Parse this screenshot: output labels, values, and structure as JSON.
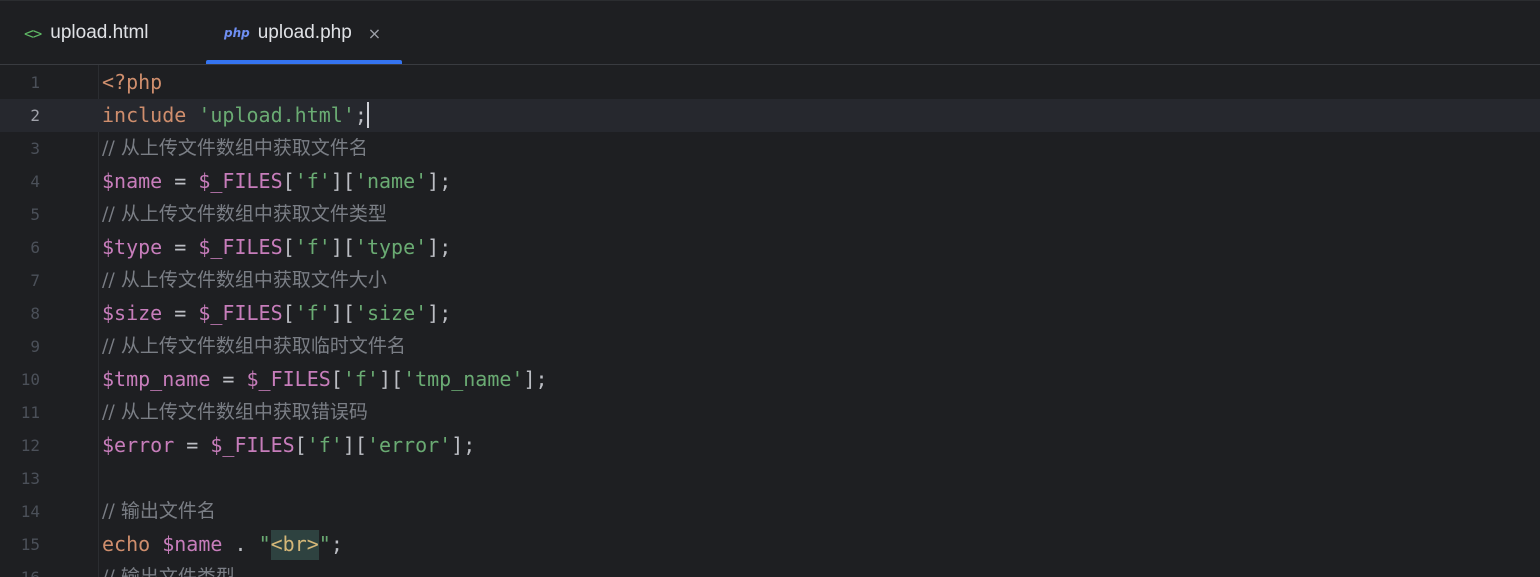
{
  "tabs": [
    {
      "icon": "html-icon",
      "icon_glyph": "<>",
      "label": "upload.html",
      "active": false
    },
    {
      "icon": "php-icon",
      "icon_glyph": "php",
      "label": "upload.php",
      "active": true,
      "close_glyph": "×"
    }
  ],
  "editor": {
    "current_line": 2,
    "lines": [
      {
        "n": "1",
        "kind": "code",
        "tokens": [
          {
            "t": "<?php",
            "c": "kw"
          }
        ]
      },
      {
        "n": "2",
        "kind": "code",
        "caret": true,
        "tokens": [
          {
            "t": "include ",
            "c": "kw"
          },
          {
            "t": "'upload.html'",
            "c": "str"
          },
          {
            "t": ";",
            "c": "punct"
          }
        ]
      },
      {
        "n": "3",
        "kind": "comment",
        "tokens": [
          {
            "t": "// 从上传文件数组中获取文件名",
            "c": "comment"
          }
        ]
      },
      {
        "n": "4",
        "kind": "code",
        "tokens": [
          {
            "t": "$name",
            "c": "var"
          },
          {
            "t": " = ",
            "c": "punct"
          },
          {
            "t": "$_FILES",
            "c": "var"
          },
          {
            "t": "[",
            "c": "punct"
          },
          {
            "t": "'f'",
            "c": "str"
          },
          {
            "t": "][",
            "c": "punct"
          },
          {
            "t": "'name'",
            "c": "str"
          },
          {
            "t": "];",
            "c": "punct"
          }
        ]
      },
      {
        "n": "5",
        "kind": "comment",
        "tokens": [
          {
            "t": "// 从上传文件数组中获取文件类型",
            "c": "comment"
          }
        ]
      },
      {
        "n": "6",
        "kind": "code",
        "tokens": [
          {
            "t": "$type",
            "c": "var"
          },
          {
            "t": " = ",
            "c": "punct"
          },
          {
            "t": "$_FILES",
            "c": "var"
          },
          {
            "t": "[",
            "c": "punct"
          },
          {
            "t": "'f'",
            "c": "str"
          },
          {
            "t": "][",
            "c": "punct"
          },
          {
            "t": "'type'",
            "c": "str"
          },
          {
            "t": "];",
            "c": "punct"
          }
        ]
      },
      {
        "n": "7",
        "kind": "comment",
        "tokens": [
          {
            "t": "// 从上传文件数组中获取文件大小",
            "c": "comment"
          }
        ]
      },
      {
        "n": "8",
        "kind": "code",
        "tokens": [
          {
            "t": "$size",
            "c": "var"
          },
          {
            "t": " = ",
            "c": "punct"
          },
          {
            "t": "$_FILES",
            "c": "var"
          },
          {
            "t": "[",
            "c": "punct"
          },
          {
            "t": "'f'",
            "c": "str"
          },
          {
            "t": "][",
            "c": "punct"
          },
          {
            "t": "'size'",
            "c": "str"
          },
          {
            "t": "];",
            "c": "punct"
          }
        ]
      },
      {
        "n": "9",
        "kind": "comment",
        "tokens": [
          {
            "t": "// 从上传文件数组中获取临时文件名",
            "c": "comment"
          }
        ]
      },
      {
        "n": "10",
        "kind": "code",
        "tokens": [
          {
            "t": "$tmp_name",
            "c": "var"
          },
          {
            "t": " = ",
            "c": "punct"
          },
          {
            "t": "$_FILES",
            "c": "var"
          },
          {
            "t": "[",
            "c": "punct"
          },
          {
            "t": "'f'",
            "c": "str"
          },
          {
            "t": "][",
            "c": "punct"
          },
          {
            "t": "'tmp_name'",
            "c": "str"
          },
          {
            "t": "];",
            "c": "punct"
          }
        ]
      },
      {
        "n": "11",
        "kind": "comment",
        "tokens": [
          {
            "t": "// 从上传文件数组中获取错误码",
            "c": "comment"
          }
        ]
      },
      {
        "n": "12",
        "kind": "code",
        "tokens": [
          {
            "t": "$error",
            "c": "var"
          },
          {
            "t": " = ",
            "c": "punct"
          },
          {
            "t": "$_FILES",
            "c": "var"
          },
          {
            "t": "[",
            "c": "punct"
          },
          {
            "t": "'f'",
            "c": "str"
          },
          {
            "t": "][",
            "c": "punct"
          },
          {
            "t": "'error'",
            "c": "str"
          },
          {
            "t": "];",
            "c": "punct"
          }
        ]
      },
      {
        "n": "13",
        "kind": "code",
        "tokens": []
      },
      {
        "n": "14",
        "kind": "comment",
        "tokens": [
          {
            "t": "// 输出文件名",
            "c": "comment"
          }
        ]
      },
      {
        "n": "15",
        "kind": "code",
        "tokens": [
          {
            "t": "echo ",
            "c": "kw"
          },
          {
            "t": "$name",
            "c": "var"
          },
          {
            "t": " . ",
            "c": "punct"
          },
          {
            "t": "\"",
            "c": "str"
          },
          {
            "t": "<br>",
            "c": "tag"
          },
          {
            "t": "\"",
            "c": "str"
          },
          {
            "t": ";",
            "c": "punct"
          }
        ]
      },
      {
        "n": "16",
        "kind": "comment",
        "tokens": [
          {
            "t": "// 输出文件类型",
            "c": "comment"
          }
        ]
      }
    ]
  },
  "colors": {
    "background": "#1e1f22",
    "current_line": "#26282e",
    "keyword": "#cf8e6d",
    "string": "#6aab73",
    "variable": "#c77dbb",
    "comment": "#7a7e85",
    "accent": "#3574f0"
  }
}
